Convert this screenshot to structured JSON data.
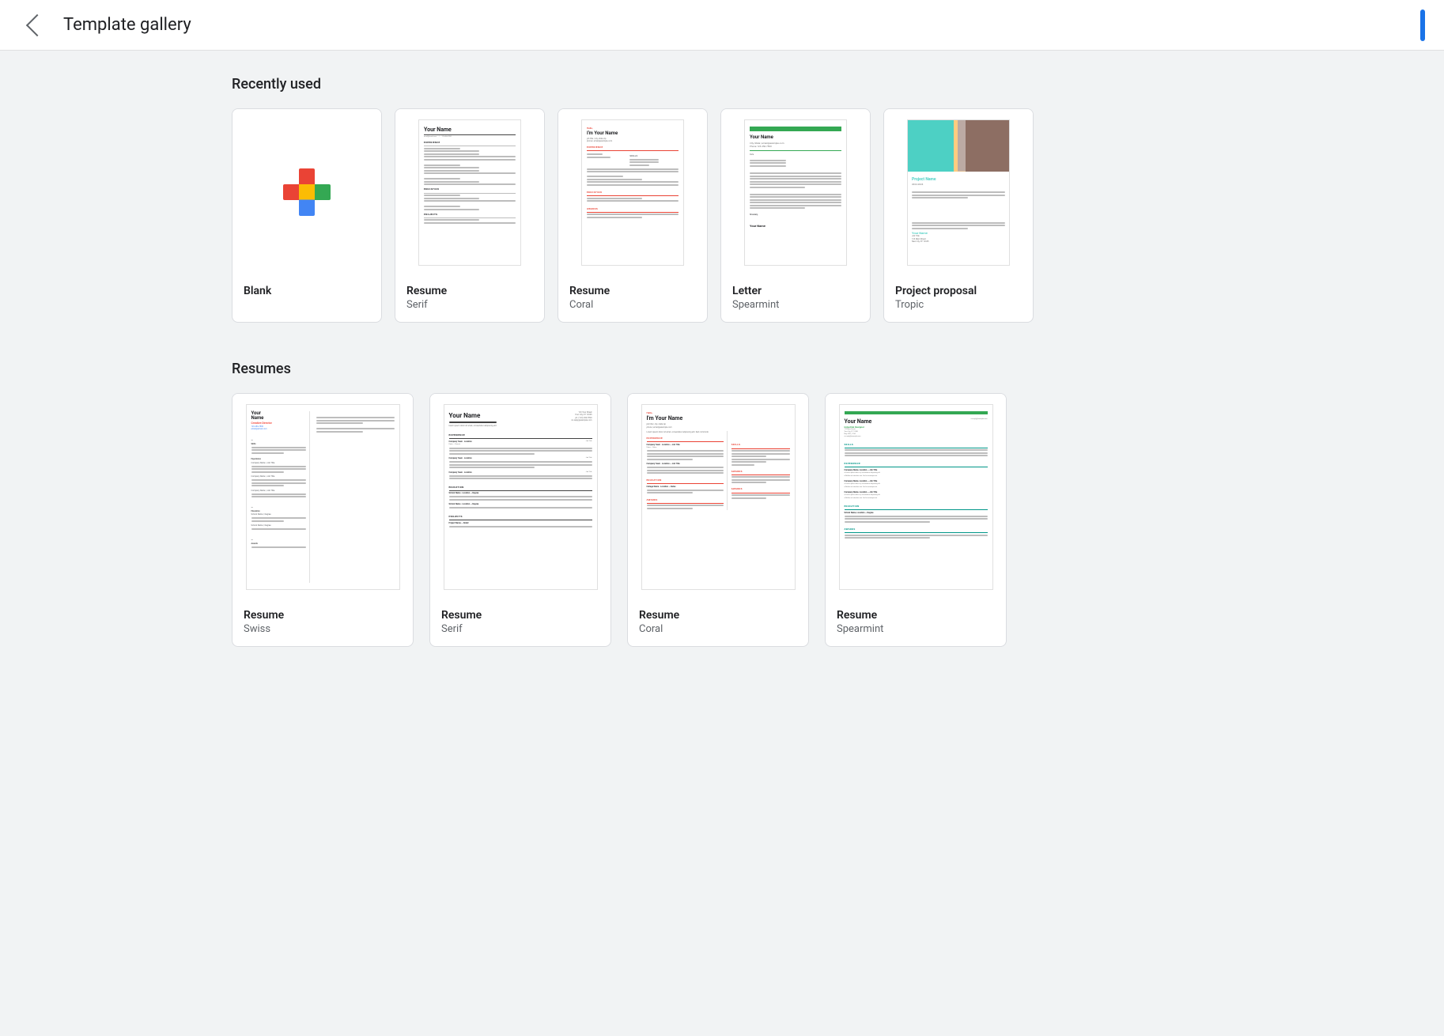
{
  "header": {
    "title": "Template gallery",
    "back_label": "back"
  },
  "recently_used": {
    "section_title": "Recently used",
    "templates": [
      {
        "id": "blank",
        "name": "Blank",
        "sub": ""
      },
      {
        "id": "resume-serif",
        "name": "Resume",
        "sub": "Serif"
      },
      {
        "id": "resume-coral",
        "name": "Resume",
        "sub": "Coral"
      },
      {
        "id": "letter-spearmint",
        "name": "Letter",
        "sub": "Spearmint"
      },
      {
        "id": "project-tropic",
        "name": "Project proposal",
        "sub": "Tropic"
      }
    ]
  },
  "resumes": {
    "section_title": "Resumes",
    "templates": [
      {
        "id": "resume-swiss",
        "name": "Resume",
        "sub": "Swiss"
      },
      {
        "id": "resume-serif-2",
        "name": "Resume",
        "sub": "Serif"
      },
      {
        "id": "resume-coral-2",
        "name": "Resume",
        "sub": "Coral"
      },
      {
        "id": "resume-spearmint",
        "name": "Resume",
        "sub": "Spearmint"
      }
    ]
  },
  "doc_content": {
    "your_name": "Your Name",
    "project_name": "Project Name"
  }
}
